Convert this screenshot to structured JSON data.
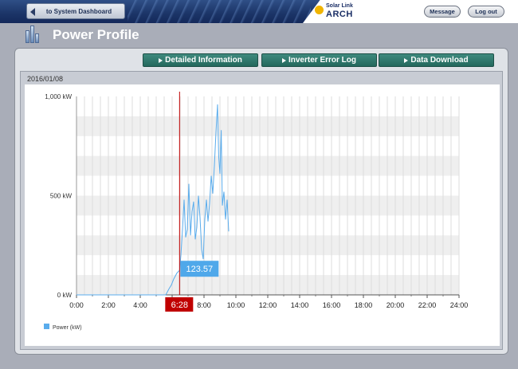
{
  "header": {
    "back_label": "to System Dashboard",
    "logo_line1": "Solar Link",
    "logo_line2": "ARCH",
    "message_label": "Message",
    "logout_label": "Log out"
  },
  "page": {
    "title": "Power Profile"
  },
  "tabs": [
    {
      "label": "Detailed Information"
    },
    {
      "label": "Inverter Error Log"
    },
    {
      "label": "Data Download"
    }
  ],
  "date": "2016/01/08",
  "colors": {
    "series": "#5aacec",
    "marker": "#c00000",
    "tooltip": "#4fa8ea"
  },
  "chart_data": {
    "type": "line",
    "x_ticks": [
      "0:00",
      "2:00",
      "4:00",
      "6:00",
      "8:00",
      "10:00",
      "12:00",
      "14:00",
      "16:00",
      "18:00",
      "20:00",
      "22:00",
      "24:00"
    ],
    "y_ticks": [
      "0 kW",
      "500 kW",
      "1,000 kW"
    ],
    "ylim": [
      0,
      1000
    ],
    "xlim_hours": [
      0,
      24
    ],
    "marker_time": "6:28",
    "marker_value": "123.57",
    "series": [
      {
        "name": "Power (kW)",
        "points": [
          [
            0,
            0
          ],
          [
            5.6,
            0
          ],
          [
            5.8,
            30
          ],
          [
            5.95,
            50
          ],
          [
            6.1,
            80
          ],
          [
            6.3,
            110
          ],
          [
            6.467,
            123.57
          ],
          [
            6.55,
            200
          ],
          [
            6.65,
            330
          ],
          [
            6.75,
            480
          ],
          [
            6.85,
            290
          ],
          [
            6.95,
            330
          ],
          [
            7.05,
            560
          ],
          [
            7.15,
            300
          ],
          [
            7.25,
            420
          ],
          [
            7.35,
            470
          ],
          [
            7.45,
            280
          ],
          [
            7.55,
            340
          ],
          [
            7.65,
            500
          ],
          [
            7.75,
            390
          ],
          [
            7.85,
            230
          ],
          [
            7.95,
            180
          ],
          [
            8.05,
            380
          ],
          [
            8.15,
            480
          ],
          [
            8.25,
            370
          ],
          [
            8.35,
            460
          ],
          [
            8.45,
            600
          ],
          [
            8.55,
            510
          ],
          [
            8.65,
            650
          ],
          [
            8.75,
            820
          ],
          [
            8.85,
            960
          ],
          [
            8.92,
            700
          ],
          [
            9.0,
            610
          ],
          [
            9.08,
            830
          ],
          [
            9.15,
            450
          ],
          [
            9.25,
            520
          ],
          [
            9.35,
            380
          ],
          [
            9.45,
            480
          ],
          [
            9.55,
            320
          ]
        ]
      }
    ],
    "legend": "bottom-left"
  }
}
